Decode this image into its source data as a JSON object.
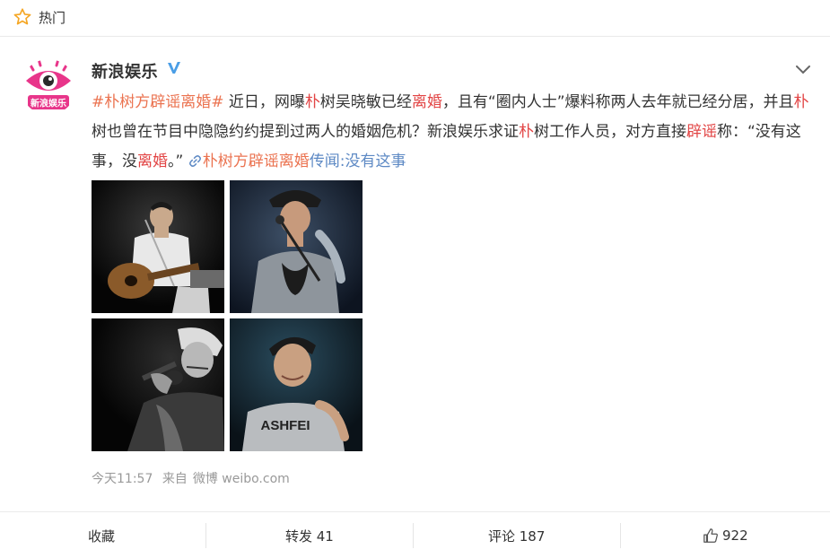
{
  "topbar": {
    "icon": "star-icon",
    "label": "热门"
  },
  "post": {
    "author": "新浪娱乐",
    "avatar_text": "新浪娱乐",
    "verified_icon": "verified-badge-icon",
    "menu_icon": "chevron-down-icon",
    "text": {
      "hashtag": "#朴树方辟谣离婚#",
      "p1": " 近日，网曝",
      "hl1": "朴",
      "p2": "树吴晓敏已经",
      "hl2": "离婚",
      "p3": "，且有“圈内人士”爆料称两人去年就已经分居，并且",
      "hl3": "朴",
      "p4": "树也曾在节目中隐隐约约提到过两人的婚姻危机？新浪娱乐求证",
      "hl4": "朴",
      "p5": "树工作人员，对方直接",
      "hl5": "辟谣",
      "p6": "称：“没有这事，没",
      "hl6": "离婚",
      "p7": "。” ",
      "link_icon": "link-icon",
      "link_text": "朴树方辟谣离婚",
      "link_text2": "传闻:没有这事"
    },
    "photos": [
      {
        "name": "photo-guitar-singer"
      },
      {
        "name": "photo-hat-singer"
      },
      {
        "name": "photo-beanie-singer"
      },
      {
        "name": "photo-smiling-singer"
      }
    ],
    "meta": {
      "time": "今天11:57",
      "source_prefix": "来自",
      "source": "微博 weibo.com"
    }
  },
  "actions": {
    "favorite": "收藏",
    "repost": "转发 41",
    "comment": "评论 187",
    "like_icon": "thumbs-up-icon",
    "like_count": "922"
  },
  "colors": {
    "hashtag": "#eb7350",
    "highlight": "#e24545",
    "link": "#5d89c4",
    "verified": "#4a9ee6",
    "star": "#f5a623"
  }
}
